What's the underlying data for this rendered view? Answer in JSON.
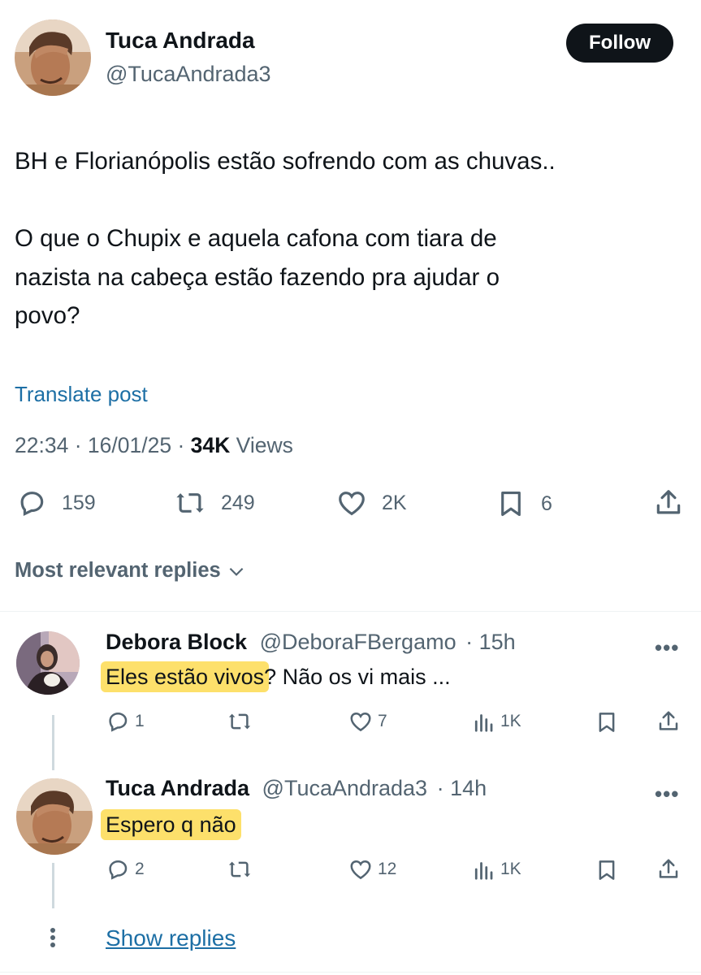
{
  "post": {
    "author_name": "Tuca Andrada",
    "author_handle": "@TucaAndrada3",
    "follow_label": "Follow",
    "text_line1": "BH e Florianópolis estão sofrendo com as chuvas..",
    "text_line2": "O que o Chupix e aquela cafona com tiara de",
    "text_line3": "nazista na cabeça estão fazendo pra ajudar o",
    "text_line4": "povo?",
    "translate_label": "Translate post",
    "time": "22:34",
    "date": "16/01/25",
    "views_count": "34K",
    "views_label": "Views",
    "separator": "·",
    "actions": {
      "replies": "159",
      "reposts": "249",
      "likes": "2K",
      "bookmarks": "6"
    }
  },
  "replies_sort_label": "Most relevant replies",
  "replies": [
    {
      "name": "Debora Block",
      "handle": "@DeboraFBergamo",
      "age": "· 15h",
      "text_highlighted": "Eles estão vivos",
      "text_rest": "? Não os vi mais ...",
      "stats": {
        "replies": "1",
        "reposts": "",
        "likes": "7",
        "views": "1K"
      }
    },
    {
      "name": "Tuca Andrada",
      "handle": "@TucaAndrada3",
      "age": "· 14h",
      "text_highlighted": "Espero q não",
      "text_rest": "",
      "stats": {
        "replies": "2",
        "reposts": "",
        "likes": "12",
        "views": "1K"
      }
    }
  ],
  "more_label": "•••",
  "show_replies_label": "Show replies",
  "colors": {
    "text": "#0f1419",
    "secondary": "#536471",
    "link": "#1d6fa5",
    "highlight": "#fde06b",
    "button": "#0f1419"
  }
}
